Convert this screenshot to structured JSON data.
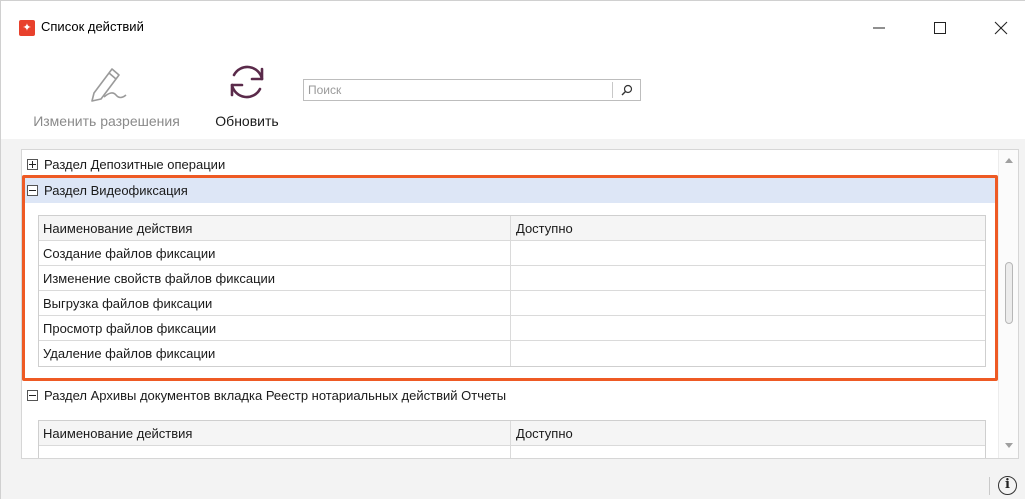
{
  "window": {
    "title": "Список действий",
    "app_icon": "app-logo-icon",
    "controls": {
      "minimize": "minimize-icon",
      "maximize": "maximize-icon",
      "close": "close-icon"
    }
  },
  "toolbar": {
    "edit_label": "Изменить разрешения",
    "edit_icon": "pen-signature-icon",
    "edit_enabled": false,
    "refresh_label": "Обновить",
    "refresh_icon": "refresh-icon",
    "search": {
      "placeholder": "Поиск",
      "value": "",
      "icon": "search-icon"
    }
  },
  "content": {
    "groups": [
      {
        "label": "Раздел Депозитные операции",
        "expanded": false,
        "selected": false
      },
      {
        "label": "Раздел Видеофиксация",
        "expanded": true,
        "selected": true,
        "columns": [
          "Наименование действия",
          "Доступно"
        ],
        "rows": [
          {
            "name": "Создание файлов фиксации",
            "available": ""
          },
          {
            "name": "Изменение свойств файлов фиксации",
            "available": ""
          },
          {
            "name": "Выгрузка файлов фиксации",
            "available": ""
          },
          {
            "name": "Просмотр файлов фиксации",
            "available": ""
          },
          {
            "name": "Удаление файлов фиксации",
            "available": ""
          }
        ]
      },
      {
        "label": "Раздел Архивы документов вкладка Реестр нотариальных действий Отчеты",
        "expanded": true,
        "selected": false,
        "columns": [
          "Наименование действия",
          "Доступно"
        ],
        "rows": []
      }
    ]
  },
  "colors": {
    "highlight_border": "#ee5a24",
    "selected_row": "#dde6f6",
    "app_icon_bg": "#e8412c"
  },
  "statusbar": {
    "info_icon": "info-icon"
  }
}
